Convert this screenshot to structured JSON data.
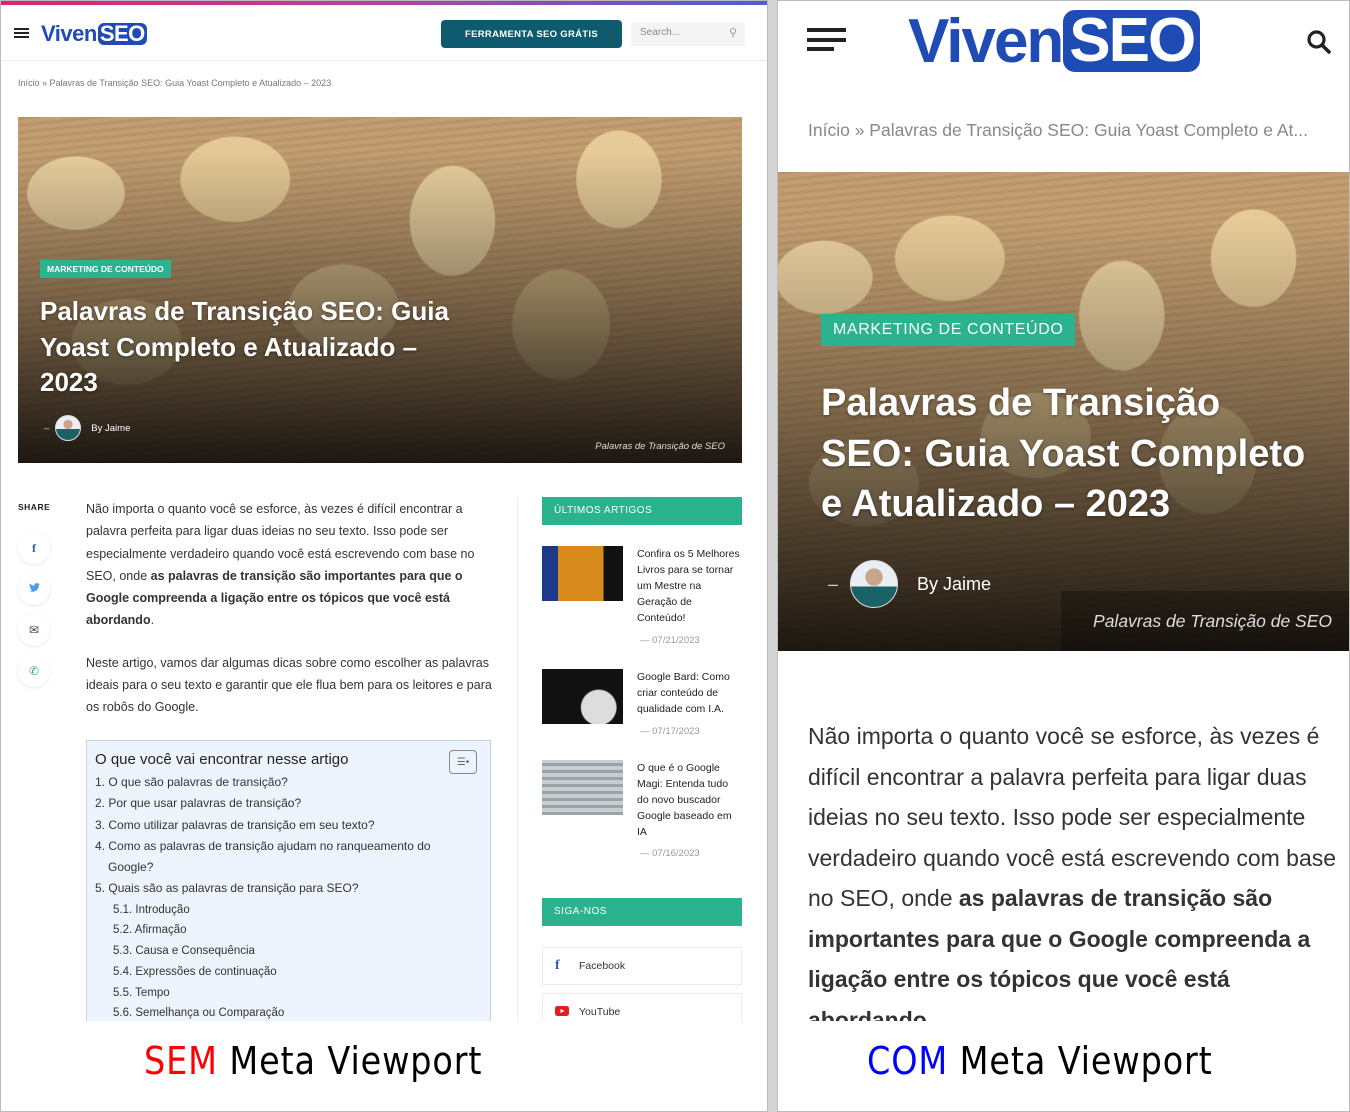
{
  "site": {
    "logo_left": "Viven",
    "logo_right": "SEO",
    "brand_color": "#1e4bb4",
    "accent_color": "#2bb38f",
    "cta_color": "#0e5a6e"
  },
  "left": {
    "header": {
      "menu_icon": "hamburger-icon",
      "cta_label": "FERRAMENTA SEO GRÁTIS",
      "theme_icon": "moon-icon",
      "search_placeholder": "Search...",
      "search_icon": "search-icon"
    },
    "breadcrumb": "Início » Palavras de Transição SEO: Guia Yoast Completo e Atualizado – 2023",
    "hero": {
      "category": "MARKETING DE CONTEÚDO",
      "title_lines": [
        "Palavras de Transição SEO: Guia",
        "Yoast Completo e Atualizado –",
        "2023"
      ],
      "dash": "–",
      "byline": "By Jaime",
      "caption": "Palavras de Transição de SEO"
    },
    "share": {
      "label": "SHARE",
      "buttons": [
        {
          "icon": "facebook-icon",
          "glyph": "f",
          "color": "#3b5ca8"
        },
        {
          "icon": "twitter-icon",
          "glyph": "🐦",
          "color": "#4a9de3"
        },
        {
          "icon": "email-icon",
          "glyph": "✉",
          "color": "#444"
        },
        {
          "icon": "whatsapp-icon",
          "glyph": "✆",
          "color": "#2bb38f"
        }
      ]
    },
    "article": {
      "p1_normal": "Não importa o quanto você se esforce, às vezes é difícil encontrar a palavra perfeita para ligar duas ideias no seu texto. Isso pode ser especialmente verdadeiro quando você está escrevendo com base no SEO, onde ",
      "p1_bold": "as palavras de transição são importantes para que o Google compreenda a ligação entre os tópicos que você está abordando",
      "p1_end": ".",
      "p2": "Neste artigo, vamos dar algumas dicas sobre como escolher as palavras ideais para o seu texto e garantir que ele flua bem para os leitores e para os robôs do Google."
    },
    "toc": {
      "title": "O que você vai encontrar nesse artigo",
      "toggle_icon": "list-toggle-icon",
      "items": [
        {
          "num": "1.",
          "text": "O que são palavras de transição?"
        },
        {
          "num": "2.",
          "text": "Por que usar palavras de transição?"
        },
        {
          "num": "3.",
          "text": "Como utilizar palavras de transição em seu texto?"
        },
        {
          "num": "4.",
          "text": "Como as palavras de transição ajudam no ranqueamento do",
          "cont": "Google?"
        },
        {
          "num": "5.",
          "text": "Quais são as palavras de transição para SEO?"
        }
      ],
      "subitems": [
        "5.1. Introdução",
        "5.2. Afirmação",
        "5.3. Causa e Consequência",
        "5.4. Expressões de continuação",
        "5.5. Tempo",
        "5.6. Semelhança ou Comparação"
      ]
    },
    "sidebar": {
      "latest_title": "ÚLTIMOS ARTIGOS",
      "posts": [
        {
          "title": "Confira os 5 Melhores Livros para se tornar um Mestre na Geração de Conteúdo!",
          "date": "07/21/2023"
        },
        {
          "title": "Google Bard: Como criar conteúdo de qualidade com I.A.",
          "date": "07/17/2023"
        },
        {
          "title": "O que é o Google Magi: Entenda tudo do novo buscador Google baseado em IA",
          "date": "07/16/2023"
        }
      ],
      "follow_title": "SIGA-NOS",
      "socials": [
        {
          "label": "Facebook",
          "icon": "facebook-icon"
        },
        {
          "label": "YouTube",
          "icon": "youtube-icon"
        }
      ]
    },
    "caption_label": {
      "highlight": "SEM",
      "rest": " Meta Viewport",
      "color": "#ff0000"
    }
  },
  "right": {
    "header": {
      "menu_icon": "hamburger-icon",
      "search_icon": "search-icon"
    },
    "breadcrumb": "Início » Palavras de Transição SEO: Guia Yoast Completo e At...",
    "hero": {
      "category": "MARKETING DE CONTEÚDO",
      "title_lines": [
        "Palavras de Transição",
        "SEO: Guia Yoast Completo",
        "e Atualizado – 2023"
      ],
      "dash": "–",
      "byline": "By Jaime",
      "caption": "Palavras de Transição de SEO"
    },
    "article": {
      "p1_normal": "Não importa o quanto você se esforce, às vezes é difícil encontrar a palavra perfeita para ligar duas ideias no seu texto. Isso pode ser especialmente verdadeiro quando você está escrevendo com base no SEO, onde ",
      "p1_bold": "as palavras de transição são importantes para que o Google compreenda a ligação entre os tópicos que você está abordando",
      "p1_end": "."
    },
    "caption_label": {
      "highlight": "COM",
      "rest": " Meta Viewport",
      "color": "#0000ff"
    }
  }
}
